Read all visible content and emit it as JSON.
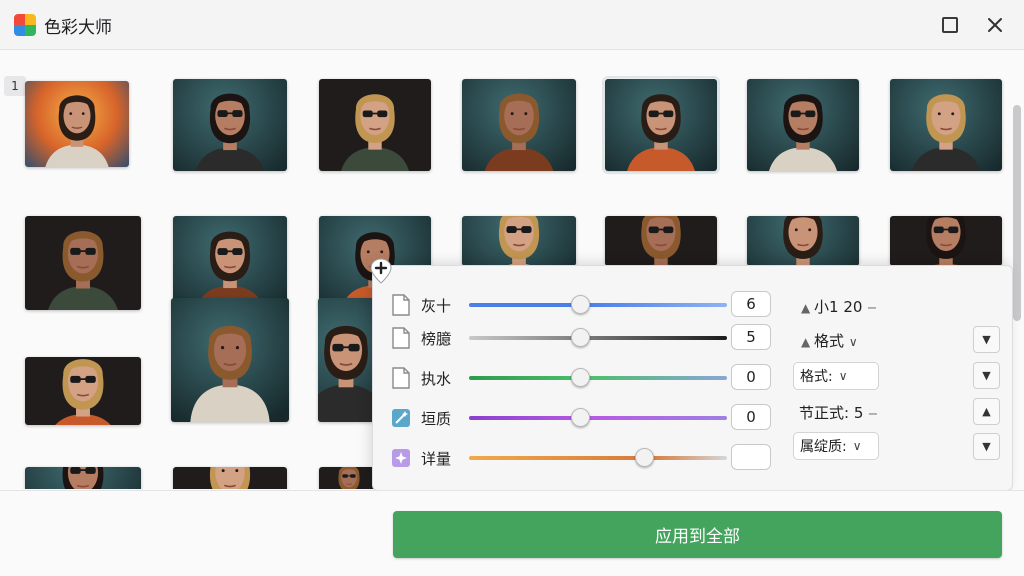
{
  "app": {
    "title": "色彩大师"
  },
  "window": {
    "maximize_icon": "maximize-icon",
    "close_glyph": "✕"
  },
  "gallery": {
    "selected_index_label": "1",
    "palette": {
      "teal": "#2f4f55",
      "dark": "#1f1c1b",
      "orange": "#e07b2c"
    }
  },
  "panel": {
    "sliders": [
      {
        "label": "灰十",
        "value": "6",
        "position": 0.43,
        "icon": "document-icon",
        "track": "blue"
      },
      {
        "label": "榜臆",
        "value": "5",
        "position": 0.43,
        "icon": "document-icon",
        "track": "gray"
      },
      {
        "label": "执水",
        "value": "0",
        "position": 0.43,
        "icon": "document-icon",
        "track": "green"
      },
      {
        "label": "垣质",
        "value": "0",
        "position": 0.43,
        "icon": "wand-icon",
        "track": "purple"
      },
      {
        "label": "详量",
        "value": "",
        "position": 0.68,
        "icon": "sparkle-icon",
        "track": "orange"
      }
    ],
    "side": {
      "size_label": "小1 20",
      "size_dash": "‒",
      "format_label": "格式",
      "format_select": "格式:",
      "section_label": "节正式: 5",
      "section_dash": "‒",
      "quality_select": "属绽质:"
    }
  },
  "footer": {
    "apply_label": "应用到全部"
  },
  "colors": {
    "accent_green": "#44a35c"
  }
}
